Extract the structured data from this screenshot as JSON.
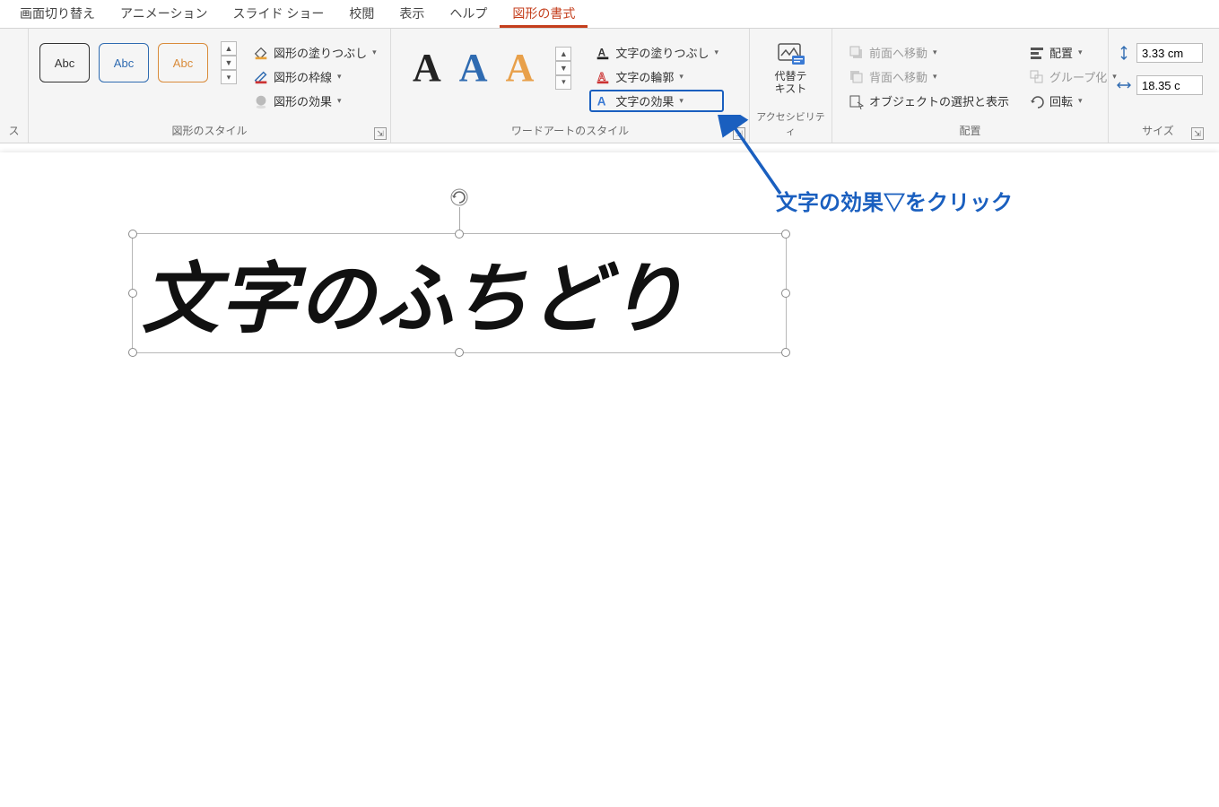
{
  "tabs": {
    "transition": "画面切り替え",
    "animation": "アニメーション",
    "slideshow": "スライド ショー",
    "review": "校閲",
    "view": "表示",
    "help": "ヘルプ",
    "shape_format": "図形の書式"
  },
  "groups": {
    "insert_shapes_suffix": "ス",
    "shape_styles": "図形のスタイル",
    "wordart_styles": "ワードアートのスタイル",
    "accessibility": "アクセシビリティ",
    "arrange": "配置",
    "size": "サイズ"
  },
  "shape_styles": {
    "thumb_label": "Abc",
    "shape_fill": "図形の塗りつぶし",
    "shape_outline": "図形の枠線",
    "shape_effects": "図形の効果"
  },
  "wordart": {
    "text_fill": "文字の塗りつぶし",
    "text_outline": "文字の輪郭",
    "text_effects": "文字の効果"
  },
  "accessibility": {
    "alt_text_l1": "代替テ",
    "alt_text_l2": "キスト"
  },
  "arrange": {
    "bring_forward": "前面へ移動",
    "send_backward": "背面へ移動",
    "selection_pane": "オブジェクトの選択と表示",
    "align": "配置",
    "group": "グループ化",
    "rotate": "回転"
  },
  "size": {
    "height": "3.33 cm",
    "width": "18.35 c"
  },
  "canvas": {
    "shape_text": "文字のふちどり"
  },
  "annotation": {
    "text": "文字の効果▽をクリック"
  }
}
